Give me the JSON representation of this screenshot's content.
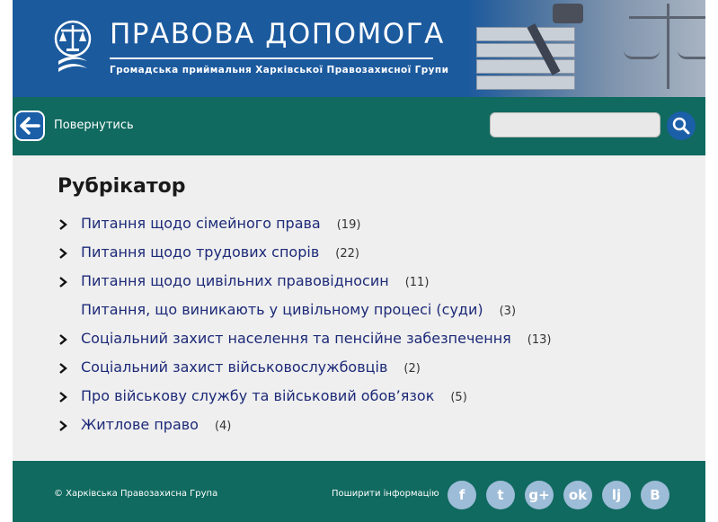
{
  "header": {
    "title": "ПРАВОВА ДОПОМОГА",
    "subtitle": "Громадська приймальня Харківської Правозахисної Групи"
  },
  "nav": {
    "back_label": "Повернутись",
    "search": {
      "value": "",
      "placeholder": ""
    }
  },
  "main": {
    "heading": "Рубрікатор",
    "items": [
      {
        "label": "Питання щодо сімейного права",
        "count": "(19)",
        "has_children": true
      },
      {
        "label": "Питання щодо трудових спорів",
        "count": "(22)",
        "has_children": true
      },
      {
        "label": "Питання щодо цивільних правовідносин",
        "count": "(11)",
        "has_children": true
      },
      {
        "label": "Питання, що виникають у цивільному процесі (суди)",
        "count": "(3)",
        "has_children": false
      },
      {
        "label": "Соціальний захист населення та пенсійне забезпечення",
        "count": "(13)",
        "has_children": true
      },
      {
        "label": "Соціальний захист військовослужбовців",
        "count": "(2)",
        "has_children": true
      },
      {
        "label": "Про військову службу та військовий обов’язок",
        "count": "(5)",
        "has_children": true
      },
      {
        "label": "Житлове право",
        "count": "(4)",
        "has_children": true
      }
    ]
  },
  "footer": {
    "copyright": "© Харківська Правозахисна Група",
    "share_label": "Поширити інформацію",
    "social": [
      {
        "icon": "facebook-icon",
        "glyph": "f"
      },
      {
        "icon": "twitter-icon",
        "glyph": "t"
      },
      {
        "icon": "google-plus-icon",
        "glyph": "g+"
      },
      {
        "icon": "odnoklassniki-icon",
        "glyph": "ok"
      },
      {
        "icon": "livejournal-icon",
        "glyph": "lj"
      },
      {
        "icon": "vkontakte-icon",
        "glyph": "B"
      }
    ]
  },
  "colors": {
    "header_blue": "#1c5a9e",
    "bar_green": "#106a5f",
    "link_navy": "#1d2a78",
    "button_blue": "#1b5fa8",
    "social_circle": "#9dbcd8"
  }
}
